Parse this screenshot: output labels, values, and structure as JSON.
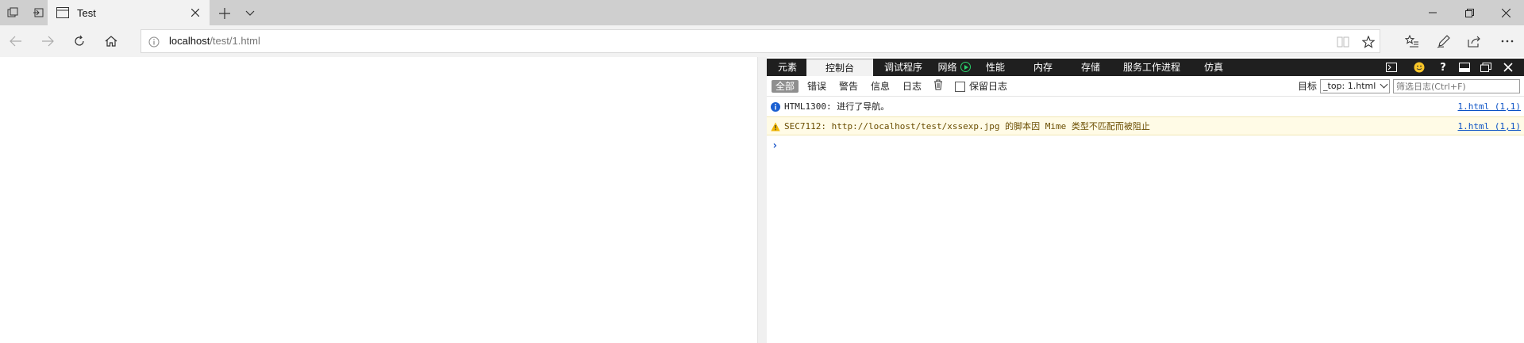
{
  "window": {
    "tab_title": "Test",
    "address": {
      "host": "localhost",
      "path": "/test/1.html"
    }
  },
  "devtools": {
    "tabs": [
      "元素",
      "控制台",
      "调试程序",
      "网络",
      "性能",
      "内存",
      "存储",
      "服务工作进程",
      "仿真"
    ],
    "active_tab": "控制台",
    "filters": {
      "all": "全部",
      "errors": "错误",
      "warnings": "警告",
      "info": "信息",
      "logs": "日志"
    },
    "preserve_log_label": "保留日志",
    "target_label": "目标",
    "target_value": "_top: 1.html",
    "filter_placeholder": "筛选日志(Ctrl+F)",
    "messages": [
      {
        "level": "info",
        "text": "HTML1300: 进行了导航。",
        "source": "1.html (1,1)"
      },
      {
        "level": "warning",
        "text": "SEC7112: http://localhost/test/xssexp.jpg 的脚本因 Mime 类型不匹配而被阻止",
        "source": "1.html (1,1)"
      }
    ],
    "prompt": "›"
  },
  "colors": {
    "info_icon": "#1a5fd1",
    "warning_icon": "#f2b705",
    "network_play": "#2bd06b"
  },
  "icons": [
    "tab-actions-icon",
    "set-aside-icon",
    "page-icon",
    "close-icon",
    "plus-icon",
    "chevron-down-icon",
    "minimize-icon",
    "restore-icon",
    "back-icon",
    "forward-icon",
    "refresh-icon",
    "home-icon",
    "info-icon",
    "reading-view-icon",
    "favorite-star-icon",
    "favorites-hub-icon",
    "pen-icon",
    "share-icon",
    "more-icon",
    "console-icon",
    "emoji-icon",
    "help-icon",
    "dock-icon",
    "undock-icon",
    "trash-icon",
    "warning-icon"
  ]
}
